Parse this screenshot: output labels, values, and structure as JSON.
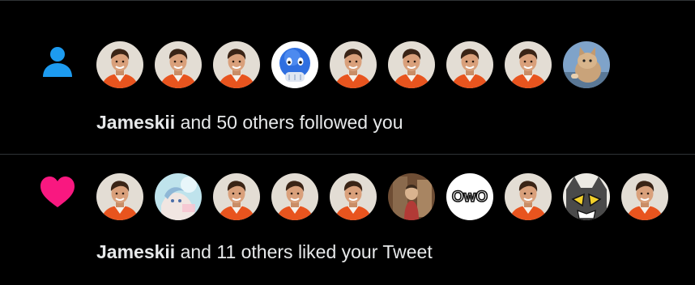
{
  "colors": {
    "background": "#000000",
    "divider": "#2f3336",
    "text": "#e7e9ea",
    "follow_icon": "#1d9bf0",
    "like_icon": "#f91880"
  },
  "notifications": [
    {
      "type": "follow",
      "icon": "person-icon",
      "user": "Jameskii",
      "text": " and 50 others followed you",
      "avatars": [
        "jameskii",
        "jameskii",
        "jameskii",
        "blue-emoji",
        "jameskii",
        "jameskii",
        "jameskii",
        "jameskii",
        "cat-photo"
      ]
    },
    {
      "type": "like",
      "icon": "heart-icon",
      "user": "Jameskii",
      "text": " and 11 others liked your Tweet",
      "avatars": [
        "jameskii",
        "anime-art",
        "jameskii",
        "jameskii",
        "jameskii",
        "brown-photo",
        "owo-face",
        "jameskii",
        "cartoon-cat",
        "jameskii"
      ]
    }
  ]
}
